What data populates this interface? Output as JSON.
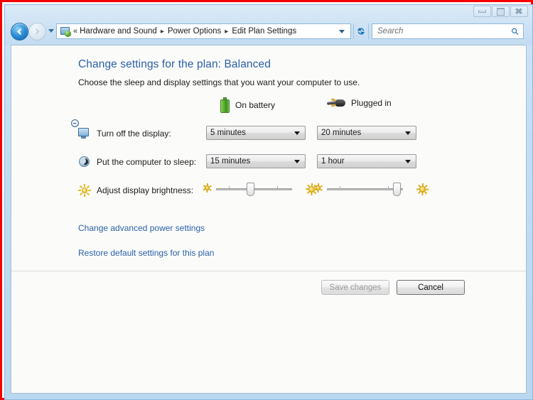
{
  "window": {
    "controls": {
      "minimize_label": "Minimize",
      "maximize_label": "Maximize",
      "close_label": "Close"
    }
  },
  "addressbar": {
    "back_label": "Back",
    "forward_label": "Forward",
    "history_label": "Recent pages",
    "leading_chevrons": "«",
    "separator": "▸",
    "breadcrumbs": [
      "Hardware and Sound",
      "Power Options",
      "Edit Plan Settings"
    ],
    "dropdown_label": "Previous locations",
    "refresh_label": "Refresh",
    "search": {
      "placeholder": "Search",
      "value": "",
      "icon": "search-icon"
    }
  },
  "page": {
    "title": "Change settings for the plan: Balanced",
    "subtitle": "Choose the sleep and display settings that you want your computer to use.",
    "title_color": "#2b5fa8",
    "link_color": "#2a5fa8"
  },
  "columns": [
    {
      "id": "battery",
      "label": "On battery",
      "icon": "battery-icon"
    },
    {
      "id": "plugged",
      "label": "Plugged in",
      "icon": "power-plug-icon"
    }
  ],
  "settings": [
    {
      "id": "turn-off-display",
      "icon": "display-icon",
      "label": "Turn off the display:",
      "battery_value": "5 minutes",
      "plugged_value": "20 minutes"
    },
    {
      "id": "computer-sleep",
      "icon": "sleep-icon",
      "label": "Put the computer to sleep:",
      "battery_value": "15 minutes",
      "plugged_value": "1 hour"
    }
  ],
  "brightness": {
    "icon": "brightness-icon",
    "label": "Adjust display brightness:",
    "low_icon": "dim-sun-icon",
    "high_icon": "bright-sun-icon",
    "battery_percent": 45,
    "plugged_percent": 92
  },
  "links": [
    {
      "id": "advanced-power-settings",
      "label": "Change advanced power settings"
    },
    {
      "id": "restore-defaults",
      "label": "Restore default settings for this plan"
    }
  ],
  "footer": {
    "save_label": "Save changes",
    "save_enabled": false,
    "cancel_label": "Cancel",
    "cancel_enabled": true
  }
}
